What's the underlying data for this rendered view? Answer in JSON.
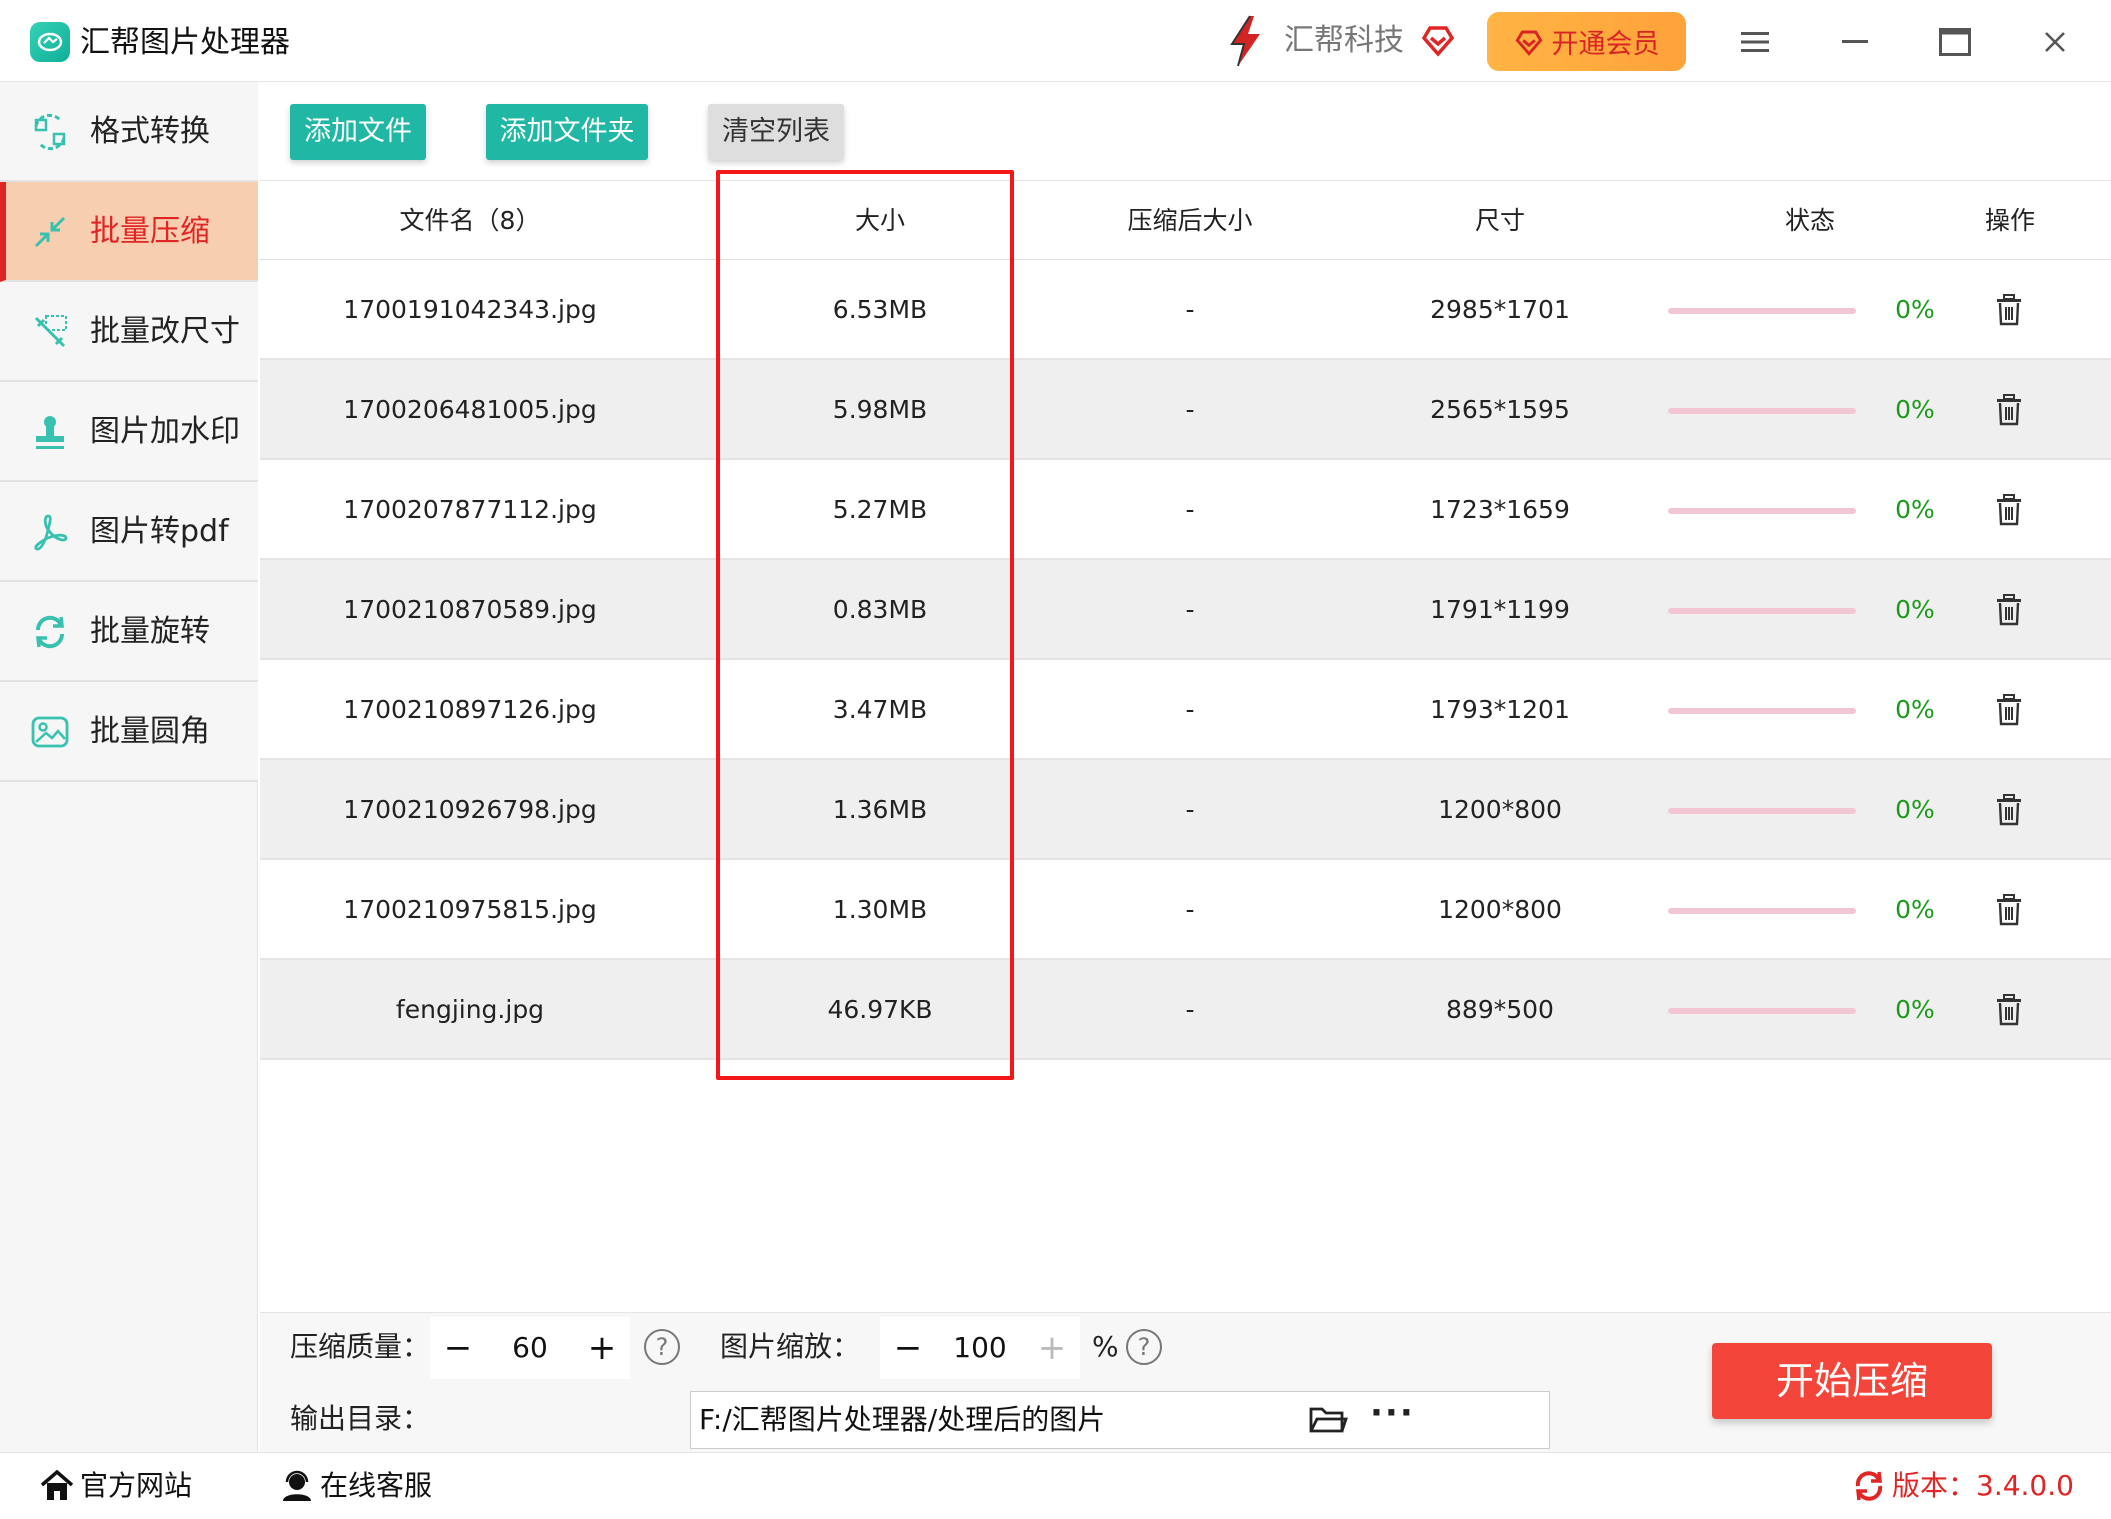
{
  "app": {
    "title": "汇帮图片处理器"
  },
  "brand": {
    "name": "汇帮科技",
    "vip_label": "开通会员"
  },
  "sidebar": {
    "items": [
      {
        "label": "格式转换",
        "icon": "format-convert-icon",
        "active": false
      },
      {
        "label": "批量压缩",
        "icon": "compress-icon",
        "active": true
      },
      {
        "label": "批量改尺寸",
        "icon": "resize-icon",
        "active": false
      },
      {
        "label": "图片加水印",
        "icon": "watermark-icon",
        "active": false
      },
      {
        "label": "图片转pdf",
        "icon": "pdf-icon",
        "active": false
      },
      {
        "label": "批量旋转",
        "icon": "rotate-icon",
        "active": false
      },
      {
        "label": "批量圆角",
        "icon": "round-corner-icon",
        "active": false
      }
    ]
  },
  "toolbar": {
    "add_file": "添加文件",
    "add_folder": "添加文件夹",
    "clear_list": "清空列表"
  },
  "table": {
    "headers": {
      "filename": "文件名（8）",
      "size": "大小",
      "compressed_size": "压缩后大小",
      "dimensions": "尺寸",
      "status": "状态",
      "action": "操作"
    },
    "rows": [
      {
        "filename": "1700191042343.jpg",
        "size": "6.53MB",
        "compressed": "-",
        "dims": "2985*1701",
        "progress": 0,
        "pct": "0%"
      },
      {
        "filename": "1700206481005.jpg",
        "size": "5.98MB",
        "compressed": "-",
        "dims": "2565*1595",
        "progress": 0,
        "pct": "0%"
      },
      {
        "filename": "1700207877112.jpg",
        "size": "5.27MB",
        "compressed": "-",
        "dims": "1723*1659",
        "progress": 0,
        "pct": "0%"
      },
      {
        "filename": "1700210870589.jpg",
        "size": "0.83MB",
        "compressed": "-",
        "dims": "1791*1199",
        "progress": 0,
        "pct": "0%"
      },
      {
        "filename": "1700210897126.jpg",
        "size": "3.47MB",
        "compressed": "-",
        "dims": "1793*1201",
        "progress": 0,
        "pct": "0%"
      },
      {
        "filename": "1700210926798.jpg",
        "size": "1.36MB",
        "compressed": "-",
        "dims": "1200*800",
        "progress": 0,
        "pct": "0%"
      },
      {
        "filename": "1700210975815.jpg",
        "size": "1.30MB",
        "compressed": "-",
        "dims": "1200*800",
        "progress": 0,
        "pct": "0%"
      },
      {
        "filename": "fengjing.jpg",
        "size": "46.97KB",
        "compressed": "-",
        "dims": "889*500",
        "progress": 0,
        "pct": "0%"
      }
    ]
  },
  "settings": {
    "quality_label": "压缩质量：",
    "quality_value": "60",
    "scale_label": "图片缩放：",
    "scale_value": "100",
    "scale_unit": "%",
    "output_label": "输出目录：",
    "output_path": "F:/汇帮图片处理器/处理后的图片",
    "more": "···",
    "start_label": "开始压缩"
  },
  "footer": {
    "website": "官方网站",
    "support": "在线客服",
    "version": "版本：3.4.0.0"
  },
  "colors": {
    "accent_teal": "#20b8a5",
    "active_red": "#e02525",
    "active_bg": "#f8ceb0",
    "start_button": "#f3453a",
    "highlight_box": "#f21818",
    "progress_track": "#f2c6d2",
    "percent_green": "#1a9a1a"
  }
}
